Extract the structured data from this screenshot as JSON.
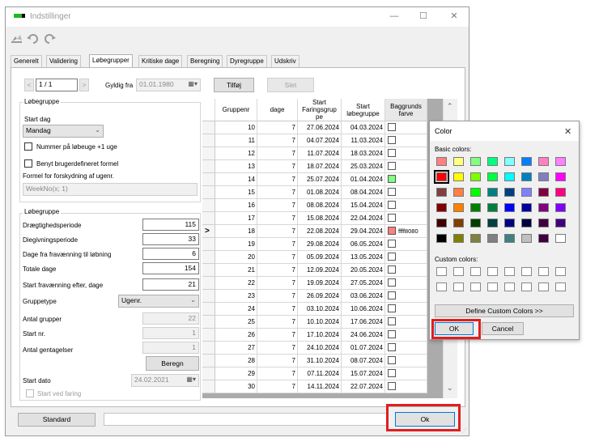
{
  "window": {
    "title": "Indstillinger",
    "minimize": "—",
    "maximize": "☐",
    "close": "✕"
  },
  "toolbar": {
    "icons": [
      "refresh-red-green-icon",
      "back-icon",
      "forward-icon"
    ]
  },
  "tabs": [
    "Generelt",
    "Validering",
    "Løbegrupper",
    "Kritiske dage",
    "Beregning",
    "Dyregruppe",
    "Udskriv"
  ],
  "nav": {
    "prev": "<",
    "next": ">",
    "position": "1 / 1",
    "gyldig_label": "Gyldig fra",
    "gyldig_value": "01.01.1980",
    "tilfoj": "Tilføj",
    "slet": "Slet"
  },
  "group1": {
    "title": "Løbegruppe",
    "start_dag_label": "Start dag",
    "start_dag_value": "Mandag",
    "nummer_cb": "Nummer på løbeuge +1 uge",
    "benyt_cb": "Benyt brugerdefineret formel",
    "formel_label": "Formel for forskydning af ugenr.",
    "formel_value": "WeekNo(x; 1)"
  },
  "group2": {
    "title": "Løbegruppe",
    "fields": [
      {
        "label": "Drægtighedsperiode",
        "value": "115"
      },
      {
        "label": "Diegivningsperiode",
        "value": "33"
      },
      {
        "label": "Dage fra fravænning til løbning",
        "value": "6"
      },
      {
        "label": "Totale dage",
        "value": "154"
      },
      {
        "label": "Start fravænning efter, dage",
        "value": "21"
      }
    ],
    "gruppetype_label": "Gruppetype",
    "gruppetype_value": "Ugenr.",
    "antal_grupper_label": "Antal grupper",
    "antal_grupper_value": "22",
    "start_nr_label": "Start nr.",
    "start_nr_value": "1",
    "antal_gentagelser_label": "Antal gentagelser",
    "antal_gentagelser_value": "1",
    "beregn": "Beregn",
    "start_dato_label": "Start dato",
    "start_dato_value": "24.02.2021",
    "start_ved_faring": "Start ved faring"
  },
  "grid": {
    "headers": [
      "Gruppenr",
      "dage",
      "Start\nFaringsgrup\npe",
      "Start\nløbegruppe",
      "Baggrunds\nfarve"
    ],
    "header_top_clip": "Start",
    "current_row_marker": ">",
    "rows": [
      {
        "nr": "10",
        "dage": "7",
        "faring": "27.06.2024",
        "lob": "04.03.2024",
        "color": ""
      },
      {
        "nr": "11",
        "dage": "7",
        "faring": "04.07.2024",
        "lob": "11.03.2024",
        "color": ""
      },
      {
        "nr": "12",
        "dage": "7",
        "faring": "11.07.2024",
        "lob": "18.03.2024",
        "color": ""
      },
      {
        "nr": "13",
        "dage": "7",
        "faring": "18.07.2024",
        "lob": "25.03.2024",
        "color": ""
      },
      {
        "nr": "14",
        "dage": "7",
        "faring": "25.07.2024",
        "lob": "01.04.2024",
        "color": "",
        "swatch": "#80ff80"
      },
      {
        "nr": "15",
        "dage": "7",
        "faring": "01.08.2024",
        "lob": "08.04.2024",
        "color": ""
      },
      {
        "nr": "16",
        "dage": "7",
        "faring": "08.08.2024",
        "lob": "15.04.2024",
        "color": ""
      },
      {
        "nr": "17",
        "dage": "7",
        "faring": "15.08.2024",
        "lob": "22.04.2024",
        "color": ""
      },
      {
        "nr": "18",
        "dage": "7",
        "faring": "22.08.2024",
        "lob": "29.04.2024",
        "color": "ffff8080",
        "swatch": "#ff8080"
      },
      {
        "nr": "19",
        "dage": "7",
        "faring": "29.08.2024",
        "lob": "06.05.2024",
        "color": ""
      },
      {
        "nr": "20",
        "dage": "7",
        "faring": "05.09.2024",
        "lob": "13.05.2024",
        "color": ""
      },
      {
        "nr": "21",
        "dage": "7",
        "faring": "12.09.2024",
        "lob": "20.05.2024",
        "color": ""
      },
      {
        "nr": "22",
        "dage": "7",
        "faring": "19.09.2024",
        "lob": "27.05.2024",
        "color": ""
      },
      {
        "nr": "23",
        "dage": "7",
        "faring": "26.09.2024",
        "lob": "03.06.2024",
        "color": ""
      },
      {
        "nr": "24",
        "dage": "7",
        "faring": "03.10.2024",
        "lob": "10.06.2024",
        "color": ""
      },
      {
        "nr": "25",
        "dage": "7",
        "faring": "10.10.2024",
        "lob": "17.06.2024",
        "color": ""
      },
      {
        "nr": "26",
        "dage": "7",
        "faring": "17.10.2024",
        "lob": "24.06.2024",
        "color": ""
      },
      {
        "nr": "27",
        "dage": "7",
        "faring": "24.10.2024",
        "lob": "01.07.2024",
        "color": ""
      },
      {
        "nr": "28",
        "dage": "7",
        "faring": "31.10.2024",
        "lob": "08.07.2024",
        "color": ""
      },
      {
        "nr": "29",
        "dage": "7",
        "faring": "07.11.2024",
        "lob": "15.07.2024",
        "color": ""
      },
      {
        "nr": "30",
        "dage": "7",
        "faring": "14.11.2024",
        "lob": "22.07.2024",
        "color": ""
      }
    ]
  },
  "bottom": {
    "standard": "Standard",
    "ok": "Ok"
  },
  "color_dialog": {
    "title": "Color",
    "close": "✕",
    "basic_label": "Basic colors:",
    "custom_label": "Custom colors:",
    "define_button": "Define Custom Colors >>",
    "ok": "OK",
    "cancel": "Cancel",
    "basic_colors": [
      "#ff8080",
      "#ffff80",
      "#80ff80",
      "#00ff80",
      "#80ffff",
      "#0080ff",
      "#ff80c0",
      "#ff80ff",
      "#ff0000",
      "#ffff00",
      "#80ff00",
      "#00ff40",
      "#00ffff",
      "#0080c0",
      "#8080c0",
      "#ff00ff",
      "#804040",
      "#ff8040",
      "#00ff00",
      "#008080",
      "#004080",
      "#8080ff",
      "#800040",
      "#ff0080",
      "#800000",
      "#ff8000",
      "#008000",
      "#008040",
      "#0000ff",
      "#0000a0",
      "#800080",
      "#8000ff",
      "#400000",
      "#804000",
      "#004000",
      "#004040",
      "#000080",
      "#000040",
      "#400040",
      "#400080",
      "#000000",
      "#808000",
      "#808040",
      "#808080",
      "#408080",
      "#c0c0c0",
      "#400040",
      "#ffffff"
    ],
    "selected_index": 8,
    "custom_count": 16
  },
  "accent": {
    "highlight_red": "#e01e1e",
    "grid_selected": "#0078d7"
  }
}
